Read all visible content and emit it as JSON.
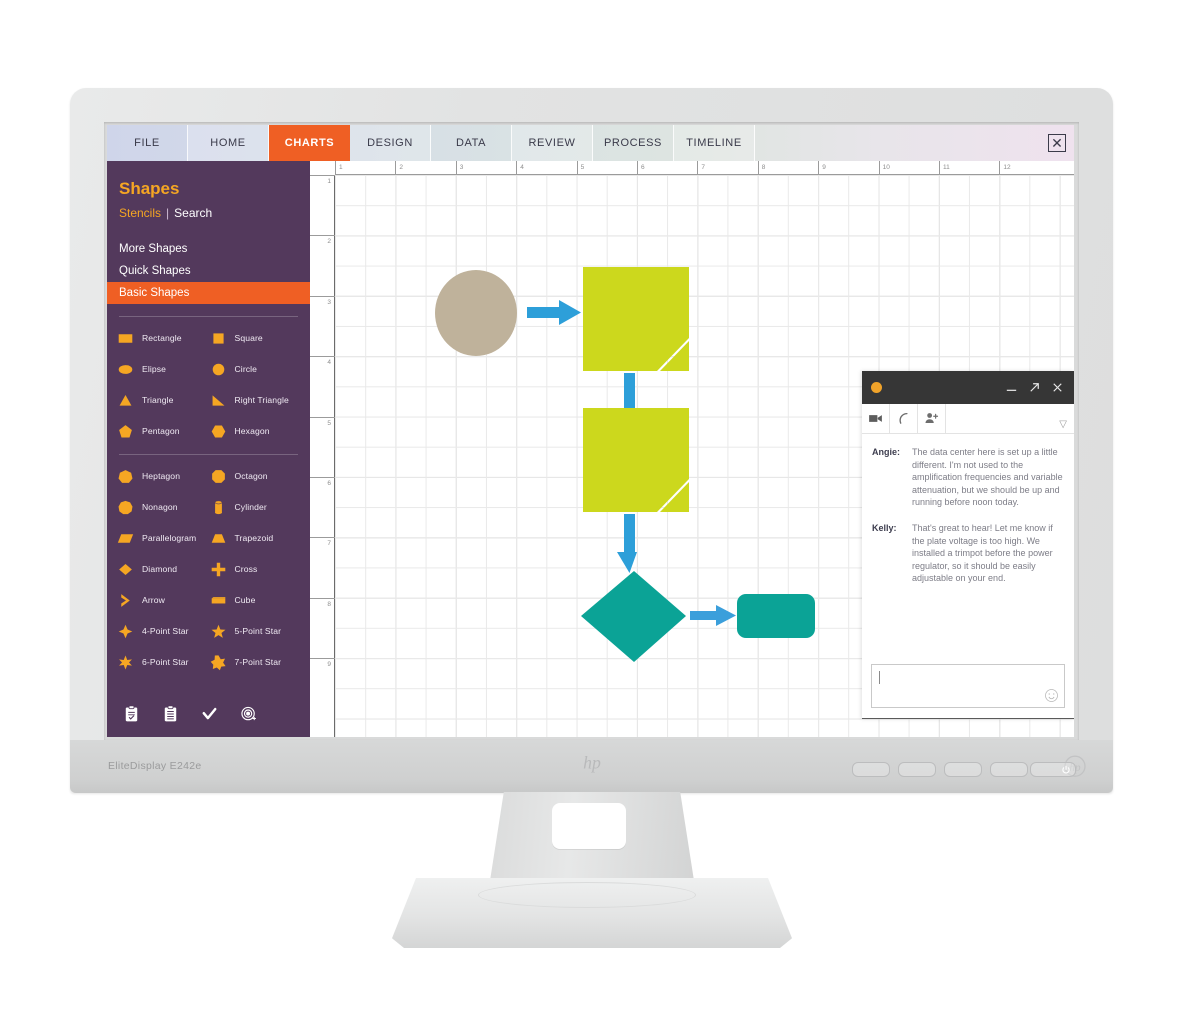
{
  "monitor": {
    "model_label": "EliteDisplay E242e",
    "brand": "hp",
    "osd_button_count": 4,
    "power_icon": "power-icon"
  },
  "app": {
    "tabs": [
      {
        "label": "FILE",
        "active": false
      },
      {
        "label": "HOME",
        "active": false
      },
      {
        "label": "CHARTS",
        "active": true
      },
      {
        "label": "DESIGN",
        "active": false
      },
      {
        "label": "DATA",
        "active": false
      },
      {
        "label": "REVIEW",
        "active": false
      },
      {
        "label": "PROCESS",
        "active": false
      },
      {
        "label": "TIMELINE",
        "active": false
      }
    ],
    "close_label": "✕",
    "accent_orange": "#ef5f24",
    "sidebar_purple": "#53395c",
    "gold": "#f5a623"
  },
  "sidebar": {
    "title": "Shapes",
    "links": {
      "stencils": "Stencils",
      "separator": "|",
      "search": "Search"
    },
    "nav": [
      {
        "label": "More Shapes",
        "active": false
      },
      {
        "label": "Quick Shapes",
        "active": false
      },
      {
        "label": "Basic Shapes",
        "active": true
      }
    ],
    "shapes_group_1": [
      {
        "label": "Rectangle",
        "icon": "rectangle-icon"
      },
      {
        "label": "Square",
        "icon": "square-icon"
      },
      {
        "label": "Elipse",
        "icon": "ellipse-icon"
      },
      {
        "label": "Circle",
        "icon": "circle-icon"
      },
      {
        "label": "Triangle",
        "icon": "triangle-icon"
      },
      {
        "label": "Right Triangle",
        "icon": "right-triangle-icon"
      },
      {
        "label": "Pentagon",
        "icon": "pentagon-icon"
      },
      {
        "label": "Hexagon",
        "icon": "hexagon-icon"
      }
    ],
    "shapes_group_2": [
      {
        "label": "Heptagon",
        "icon": "heptagon-icon"
      },
      {
        "label": "Octagon",
        "icon": "octagon-icon"
      },
      {
        "label": "Nonagon",
        "icon": "nonagon-icon"
      },
      {
        "label": "Cylinder",
        "icon": "cylinder-icon"
      },
      {
        "label": "Parallelogram",
        "icon": "parallelogram-icon"
      },
      {
        "label": "Trapezoid",
        "icon": "trapezoid-icon"
      },
      {
        "label": "Diamond",
        "icon": "diamond-icon"
      },
      {
        "label": "Cross",
        "icon": "cross-icon"
      },
      {
        "label": "Arrow",
        "icon": "arrow-icon"
      },
      {
        "label": "Cube",
        "icon": "cube-icon"
      },
      {
        "label": "4-Point Star",
        "icon": "star-4-icon"
      },
      {
        "label": "5-Point Star",
        "icon": "star-5-icon"
      },
      {
        "label": "6-Point Star",
        "icon": "star-6-icon"
      },
      {
        "label": "7-Point Star",
        "icon": "star-7-icon"
      }
    ],
    "footer_icons": [
      "clipboard-check-icon",
      "clipboard-list-icon",
      "checkmark-icon",
      "target-icon"
    ]
  },
  "canvas": {
    "ruler_h": [
      "1",
      "2",
      "3",
      "4",
      "5",
      "6",
      "7",
      "8",
      "9",
      "10",
      "11",
      "12"
    ],
    "ruler_v": [
      "1",
      "2",
      "3",
      "4",
      "5",
      "6",
      "7",
      "8",
      "9"
    ],
    "grid": "on",
    "diagram": {
      "nodes": [
        {
          "name": "start-ellipse",
          "shape": "ellipse",
          "color": "#bfb29b"
        },
        {
          "name": "document-1",
          "shape": "folded-corner-square",
          "color": "#ccd81d"
        },
        {
          "name": "document-2",
          "shape": "folded-corner-square",
          "color": "#ccd81d"
        },
        {
          "name": "decision-diamond",
          "shape": "diamond",
          "color": "#0ba396"
        },
        {
          "name": "end-rounded-rect",
          "shape": "rounded-rect",
          "color": "#0ba396"
        }
      ],
      "connectors": [
        {
          "name": "connector-right-1",
          "direction": "right",
          "color": "#2d9fd9"
        },
        {
          "name": "connector-down-1",
          "direction": "down",
          "color": "#2d9fd9"
        },
        {
          "name": "connector-down-2",
          "direction": "down",
          "color": "#2d9fd9"
        },
        {
          "name": "connector-right-2",
          "direction": "right",
          "color": "#3b9fdb"
        }
      ]
    }
  },
  "chat": {
    "titlebar": {
      "avatar": "orange-avatar-icon",
      "minimize": "minimize-icon",
      "expand": "expand-icon",
      "close": "close-icon"
    },
    "toolbar": {
      "video": "video-camera-icon",
      "call": "phone-call-icon",
      "add_person": "add-person-icon",
      "caret": "chevron-down-icon"
    },
    "messages": [
      {
        "sender": "Angie:",
        "text": "The data center here is set up a little different. I'm not used to the amplification frequencies and variable attenuation, but we should be up and running before noon today."
      },
      {
        "sender": "Kelly:",
        "text": "That's great to hear! Let me know if the plate voltage is too high. We installed a trimpot before the power regulator, so it should be easily adjustable on your end."
      }
    ],
    "input": {
      "value": "",
      "placeholder": "",
      "emoji_icon": "smiley-icon"
    }
  }
}
